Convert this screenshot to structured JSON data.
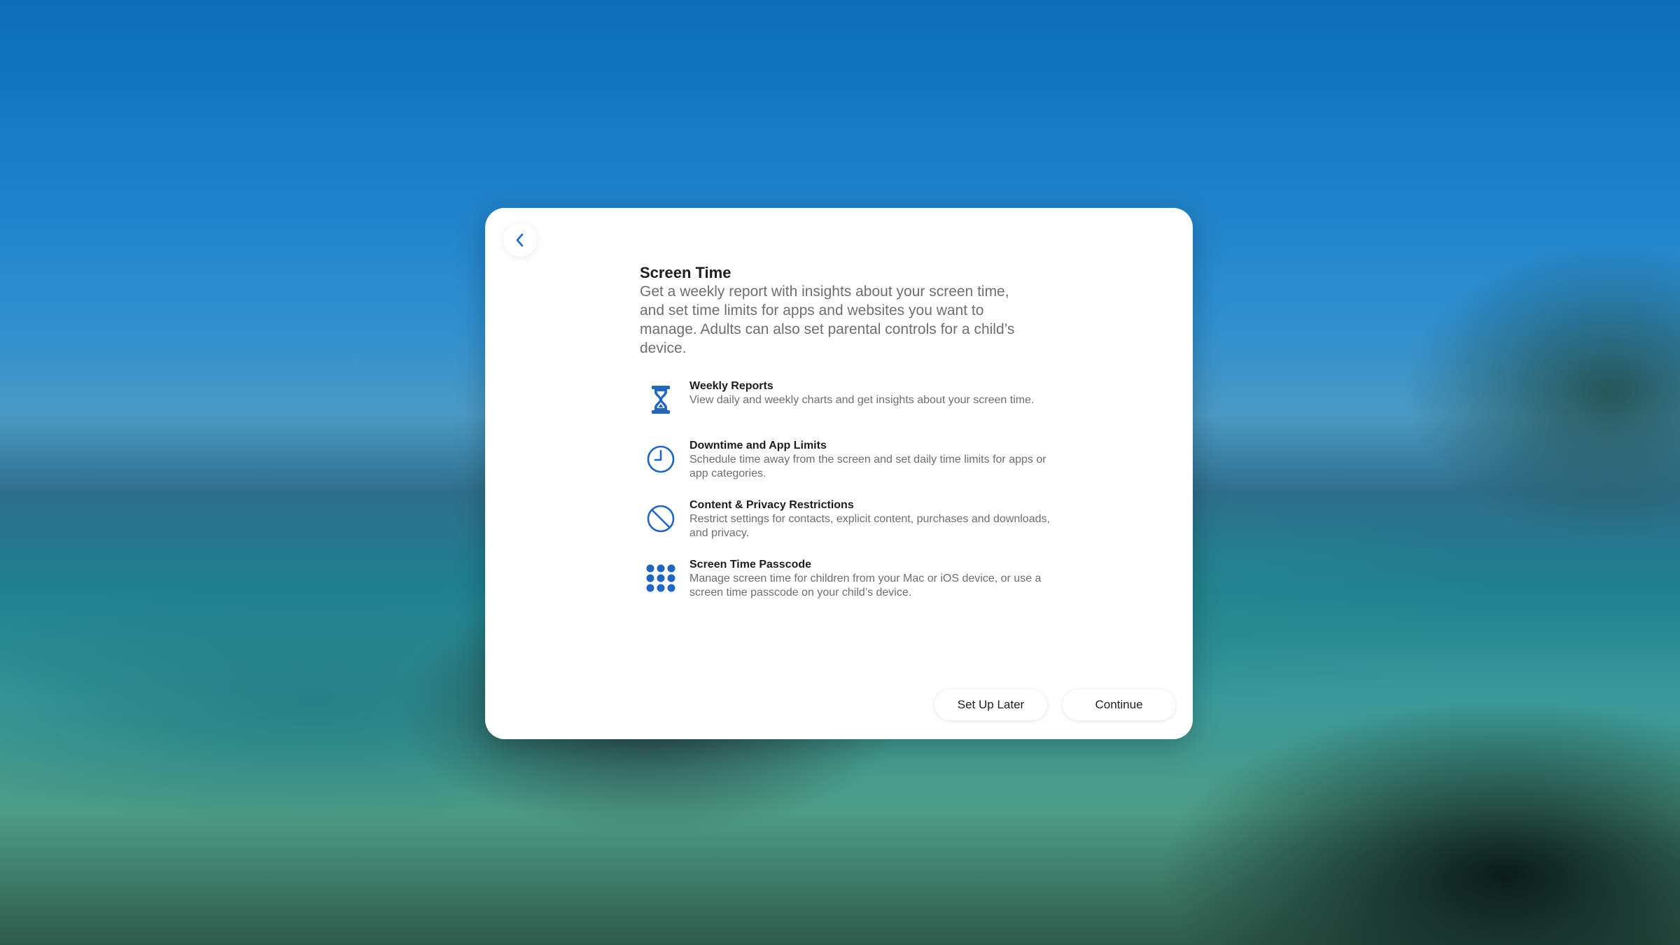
{
  "header": {
    "back_icon": "chevron-left-icon"
  },
  "main": {
    "title": "Screen Time",
    "description": "Get a weekly report with insights about your screen time, and set time limits for apps and websites you want to manage. Adults can also set parental controls for a child’s device.",
    "features": [
      {
        "icon": "hourglass-icon",
        "title": "Weekly Reports",
        "description": "View daily and weekly charts and get insights about your screen time."
      },
      {
        "icon": "clock-icon",
        "title": "Downtime and App Limits",
        "description": "Schedule time away from the screen and set daily time limits for apps or app categories."
      },
      {
        "icon": "prohibited-icon",
        "title": "Content & Privacy Restrictions",
        "description": "Restrict settings for contacts, explicit content, purchases and downloads, and privacy."
      },
      {
        "icon": "keypad-icon",
        "title": "Screen Time Passcode",
        "description": "Manage screen time for children from your Mac or iOS device, or use a screen time passcode on your child’s device."
      }
    ]
  },
  "footer": {
    "later_label": "Set Up Later",
    "continue_label": "Continue"
  },
  "colors": {
    "accent": "#1f66c2",
    "dialog_background": "#ffffff"
  }
}
